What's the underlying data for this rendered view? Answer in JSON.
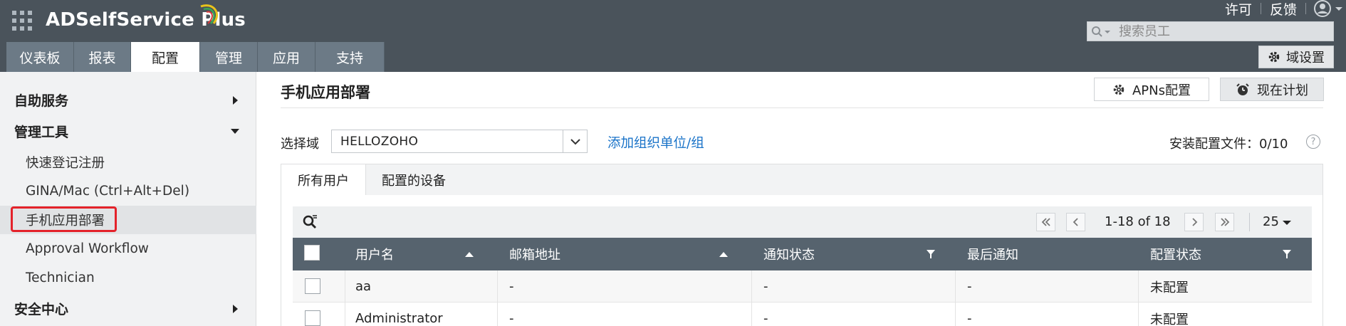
{
  "app": {
    "title": "ADSelfService Plus"
  },
  "top_links": {
    "license": "许可",
    "feedback": "反馈"
  },
  "search": {
    "placeholder": "搜索员工"
  },
  "nav": {
    "tabs": [
      {
        "label": "仪表板",
        "active": false
      },
      {
        "label": "报表",
        "active": false
      },
      {
        "label": "配置",
        "active": true
      },
      {
        "label": "管理",
        "active": false
      },
      {
        "label": "应用",
        "active": false
      },
      {
        "label": "支持",
        "active": false
      }
    ],
    "domain_settings": "域设置"
  },
  "sidebar": {
    "items": [
      {
        "label": "自助服务",
        "type": "section",
        "expanded": false
      },
      {
        "label": "管理工具",
        "type": "section",
        "expanded": true
      },
      {
        "label": "快速登记注册",
        "type": "sub"
      },
      {
        "label": "GINA/Mac (Ctrl+Alt+Del)",
        "type": "sub"
      },
      {
        "label": "手机应用部署",
        "type": "sub",
        "selected": true
      },
      {
        "label": "Approval Workflow",
        "type": "sub"
      },
      {
        "label": "Technician",
        "type": "sub"
      },
      {
        "label": "安全中心",
        "type": "section",
        "expanded": false
      }
    ]
  },
  "main": {
    "title": "手机应用部署",
    "apns_button": "APNs配置",
    "schedule_button": "现在计划",
    "domain_label": "选择域",
    "domain_value": "HELLOZOHO",
    "add_link": "添加组织单位/组",
    "install_info": "安装配置文件：0/10",
    "help": "?",
    "tabs": [
      {
        "label": "所有用户",
        "active": true
      },
      {
        "label": "配置的设备",
        "active": false
      }
    ]
  },
  "table": {
    "pagination": {
      "range": "1-18 of 18",
      "page_size": "25"
    },
    "columns": [
      "用户名",
      "邮箱地址",
      "通知状态",
      "最后通知",
      "配置状态"
    ],
    "rows": [
      {
        "username": "aa",
        "email": "-",
        "notify_status": "-",
        "last_notified": "-",
        "config_status": "未配置"
      },
      {
        "username": "Administrator",
        "email": "-",
        "notify_status": "-",
        "last_notified": "-",
        "config_status": "未配置"
      }
    ]
  },
  "colors": {
    "header_bg": "#4a535b",
    "nav_tab_bg": "#6c7a86",
    "table_header_bg": "#56636e",
    "link": "#1a73c8",
    "highlight": "#e4222a"
  }
}
